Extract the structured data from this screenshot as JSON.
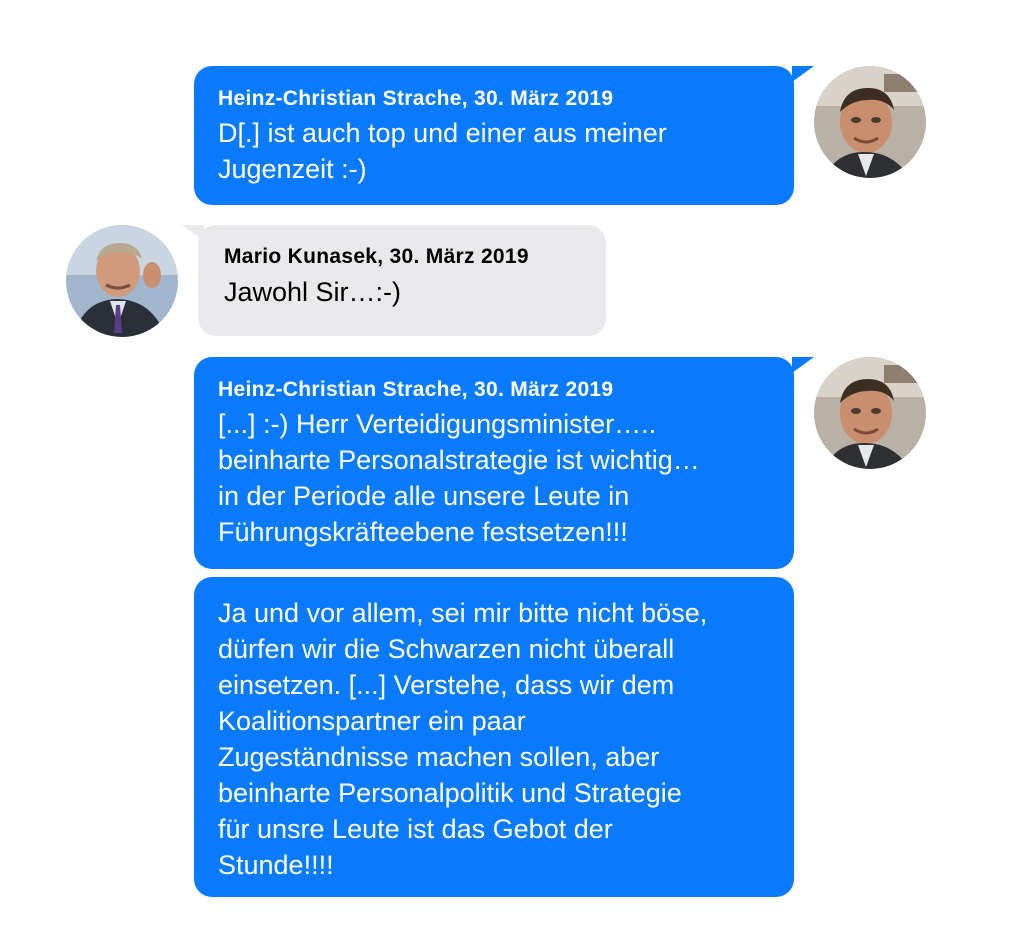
{
  "messages": [
    {
      "sender": "Heinz-Christian Strache, 30. März 2019",
      "text": "D[.] ist auch top und einer aus meiner\nJugenzeit :-)"
    },
    {
      "sender": "Mario Kunasek, 30. März 2019",
      "text": "Jawohl Sir…:-)"
    },
    {
      "sender": "Heinz-Christian Strache, 30. März 2019",
      "text": "[...] :-) Herr Verteidigungsminister…..\nbeinharte Personalstrategie ist wichtig…\nin der Periode alle unsere Leute in\nFührungskräfteebene festsetzen!!!"
    },
    {
      "sender": "",
      "text": "Ja und vor allem, sei mir bitte nicht böse,\ndürfen wir die Schwarzen nicht überall\neinsetzen. [...] Verstehe, dass wir dem\nKoalitionspartner ein paar\nZugeständnisse machen sollen, aber\nbeinharte Personalpolitik und Strategie\nfür unsre Leute ist das Gebot der\nStunde!!!!"
    }
  ],
  "colors": {
    "sent_bubble": "#0a7aff",
    "received_bubble": "#e9e9eb"
  }
}
